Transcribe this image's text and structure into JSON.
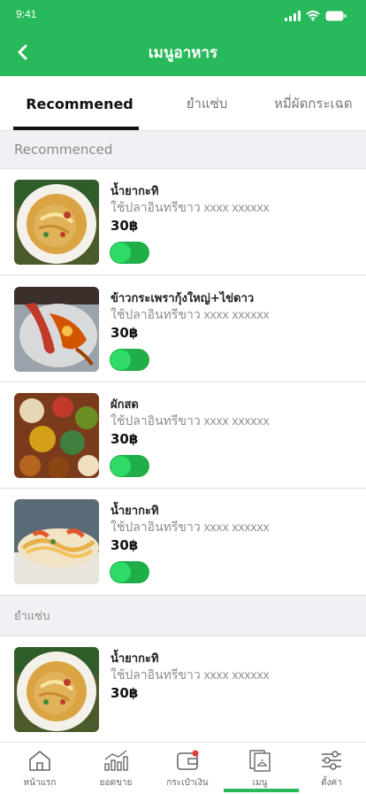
{
  "status_bar": {
    "time": "9:41"
  },
  "header": {
    "title": "เมนูอาหาร"
  },
  "tabs": [
    {
      "label": "Recommened",
      "active": true
    },
    {
      "label": "ยำแซ่บ",
      "active": false
    },
    {
      "label": "หมี่ผัดกระเฉด",
      "active": false
    }
  ],
  "sections": [
    {
      "title": "Recommenced"
    },
    {
      "title": "ยำแซ่บ"
    }
  ],
  "items": [
    {
      "name": "น้ำยากะทิ",
      "description": "ใช้ปลาอินทรีขาว xxxx xxxxxx",
      "price": "30฿",
      "enabled": true
    },
    {
      "name": "ข้าวกระเพรากุ้งใหญ่+ไข่ดาว",
      "description": "ใช้ปลาอินทรีขาว xxxx xxxxxx",
      "price": "30฿",
      "enabled": true
    },
    {
      "name": "ผักสด",
      "description": "ใช้ปลาอินทรีขาว xxxx xxxxxx",
      "price": "30฿",
      "enabled": true
    },
    {
      "name": "น้ำยากะทิ",
      "description": "ใช้ปลาอินทรีขาว xxxx xxxxxx",
      "price": "30฿",
      "enabled": true
    },
    {
      "name": "น้ำยากะทิ",
      "description": "ใช้ปลาอินทรีขาว xxxx xxxxxx",
      "price": "30฿"
    }
  ],
  "bottom_nav": [
    {
      "label": "หน้าแรก",
      "icon": "home-icon"
    },
    {
      "label": "ยอดขาย",
      "icon": "sales-chart-icon"
    },
    {
      "label": "กระเป๋าเงิน",
      "icon": "wallet-icon",
      "badge": true
    },
    {
      "label": "เมนู",
      "icon": "menu-book-icon",
      "active": true
    },
    {
      "label": "ตั้งค่า",
      "icon": "settings-sliders-icon"
    }
  ],
  "colors": {
    "primary": "#27b95a",
    "toggle_on": "#2fdb67",
    "section_bg": "#f0f1f4",
    "badge": "#e53935"
  }
}
